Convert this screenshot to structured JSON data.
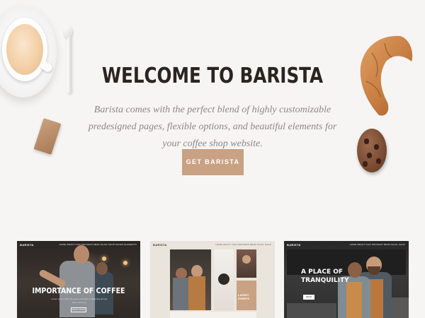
{
  "hero": {
    "title": "WELCOME TO BARISTA",
    "subtitle": "Barista comes with the perfect blend of highly customizable predesigned pages, flexible options, and beautiful elements for your coffee shop website.",
    "cta_label": "GET BARISTA"
  },
  "colors": {
    "background": "#f6f5f4",
    "title": "#2b2420",
    "subtitle": "#8e8883",
    "accent": "#c9a183"
  },
  "decor": {
    "items": [
      "coffee-cup",
      "spoon",
      "sugar-packet",
      "croissant",
      "cookie"
    ]
  },
  "demos": [
    {
      "brand": "BARISTA",
      "nav": "HOME  ABOUT  OUR PROCESS  MENU  BLOG  SHOP  PAGES  ELEMENTS",
      "heading": "IMPORTANCE OF COFFEE",
      "text": "Lorem ipsum dolor sit amet consectetuer adipiscing elit sed diam nonummy",
      "button": "READ MORE"
    },
    {
      "brand": "BARISTA",
      "nav": "HOME  ABOUT  OUR PROCESS  MENU  BLOG  SHOP",
      "tile_label": "LATEST EVENTS"
    },
    {
      "brand": "BARISTA",
      "nav": "HOME  ABOUT  OUR PROCESS  MENU  BLOG  SHOP",
      "heading": "A PLACE OF TRANQUILITY",
      "button": "READ"
    }
  ]
}
